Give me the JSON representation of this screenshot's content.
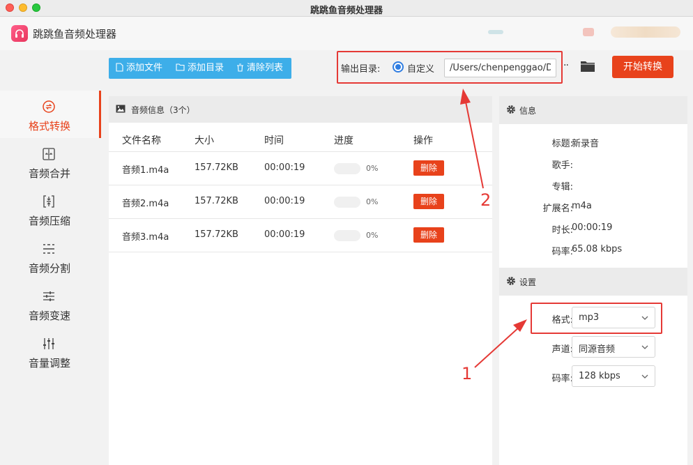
{
  "window": {
    "title": "跳跳鱼音频处理器"
  },
  "app": {
    "name": "跳跳鱼音频处理器"
  },
  "sidebar": {
    "items": [
      {
        "label": "格式转换",
        "icon": "format-convert-icon",
        "active": true
      },
      {
        "label": "音频合并",
        "icon": "merge-icon",
        "active": false
      },
      {
        "label": "音频压缩",
        "icon": "compress-icon",
        "active": false
      },
      {
        "label": "音频分割",
        "icon": "split-icon",
        "active": false
      },
      {
        "label": "音频变速",
        "icon": "speed-icon",
        "active": false
      },
      {
        "label": "音量调整",
        "icon": "volume-icon",
        "active": false
      }
    ]
  },
  "toolbar": {
    "add_file": "添加文件",
    "add_dir": "添加目录",
    "clear_list": "清除列表"
  },
  "output": {
    "label": "输出目录:",
    "radio_label": "自定义",
    "path": "/Users/chenpenggao/Desktop",
    "more": "··",
    "start_button": "开始转换"
  },
  "files": {
    "header": "音频信息（3个）",
    "columns": [
      "文件名称",
      "大小",
      "时间",
      "进度",
      "操作"
    ],
    "rows": [
      {
        "name": "音频1.m4a",
        "size": "157.72KB",
        "time": "00:00:19",
        "progress": "0%",
        "progress_value": 0,
        "action": "删除"
      },
      {
        "name": "音频2.m4a",
        "size": "157.72KB",
        "time": "00:00:19",
        "progress": "0%",
        "progress_value": 0,
        "action": "删除"
      },
      {
        "name": "音频3.m4a",
        "size": "157.72KB",
        "time": "00:00:19",
        "progress": "0%",
        "progress_value": 0,
        "action": "删除"
      }
    ]
  },
  "info": {
    "header": "信息",
    "fields": [
      {
        "key": "标题:",
        "value": "新录音"
      },
      {
        "key": "歌手:",
        "value": ""
      },
      {
        "key": "专辑:",
        "value": ""
      },
      {
        "key": "扩展名:",
        "value": "m4a"
      },
      {
        "key": "时长:",
        "value": "00:00:19"
      },
      {
        "key": "码率:",
        "value": "65.08 kbps"
      }
    ]
  },
  "settings": {
    "header": "设置",
    "format_label": "格式:",
    "format_value": "mp3",
    "channel_label": "声道:",
    "channel_value": "同源音频",
    "bitrate_label": "码率:",
    "bitrate_value": "128 kbps"
  },
  "annotations": {
    "one": "1",
    "two": "2",
    "color": "#e53935"
  },
  "colors": {
    "accent": "#e8421b",
    "toolbar": "#3daee9",
    "radio": "#2f7de1"
  }
}
